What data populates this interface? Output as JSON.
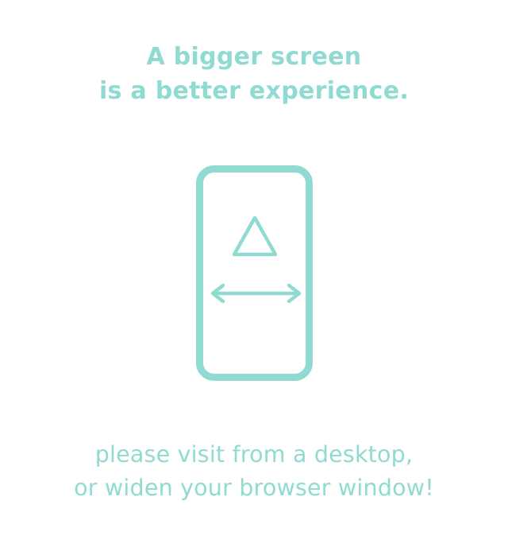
{
  "headline": {
    "line1": "A bigger screen",
    "line2": "is a better experience."
  },
  "footer": {
    "line1": "please visit from a desktop,",
    "line2": "or widen your browser window!"
  },
  "colors": {
    "accent": "#8fdbd1",
    "background": "#ffffff"
  },
  "icons": {
    "device": "phone-outline-icon",
    "rotate": "triangle-icon",
    "widen": "double-arrow-horizontal-icon"
  }
}
